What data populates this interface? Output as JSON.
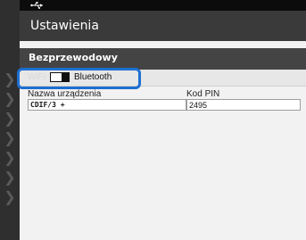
{
  "colors": {
    "accent": "#1e6fd2",
    "header_dark": "#3a3a3a",
    "section_header": "#444444",
    "content_bg": "#f2f2f2"
  },
  "status_bar": {
    "icon": "usb-icon"
  },
  "left_strip": {
    "icons": [
      "chevron-right-icon",
      "chevron-right-icon",
      "chevron-right-icon",
      "chevron-right-icon",
      "chevron-right-icon",
      "chevron-right-icon",
      "chevron-right-icon"
    ]
  },
  "title": "Ustawienia",
  "section": {
    "title": "Bezprzewodowy",
    "toggle": {
      "wifi_label": "WiFi",
      "bluetooth_label": "Bluetooth",
      "state": "bluetooth"
    }
  },
  "fields": {
    "device_name": {
      "label": "Nazwa urządzenia",
      "value": "CDIF/3 +"
    },
    "pin": {
      "label": "Kod PIN",
      "value": "2495"
    }
  }
}
